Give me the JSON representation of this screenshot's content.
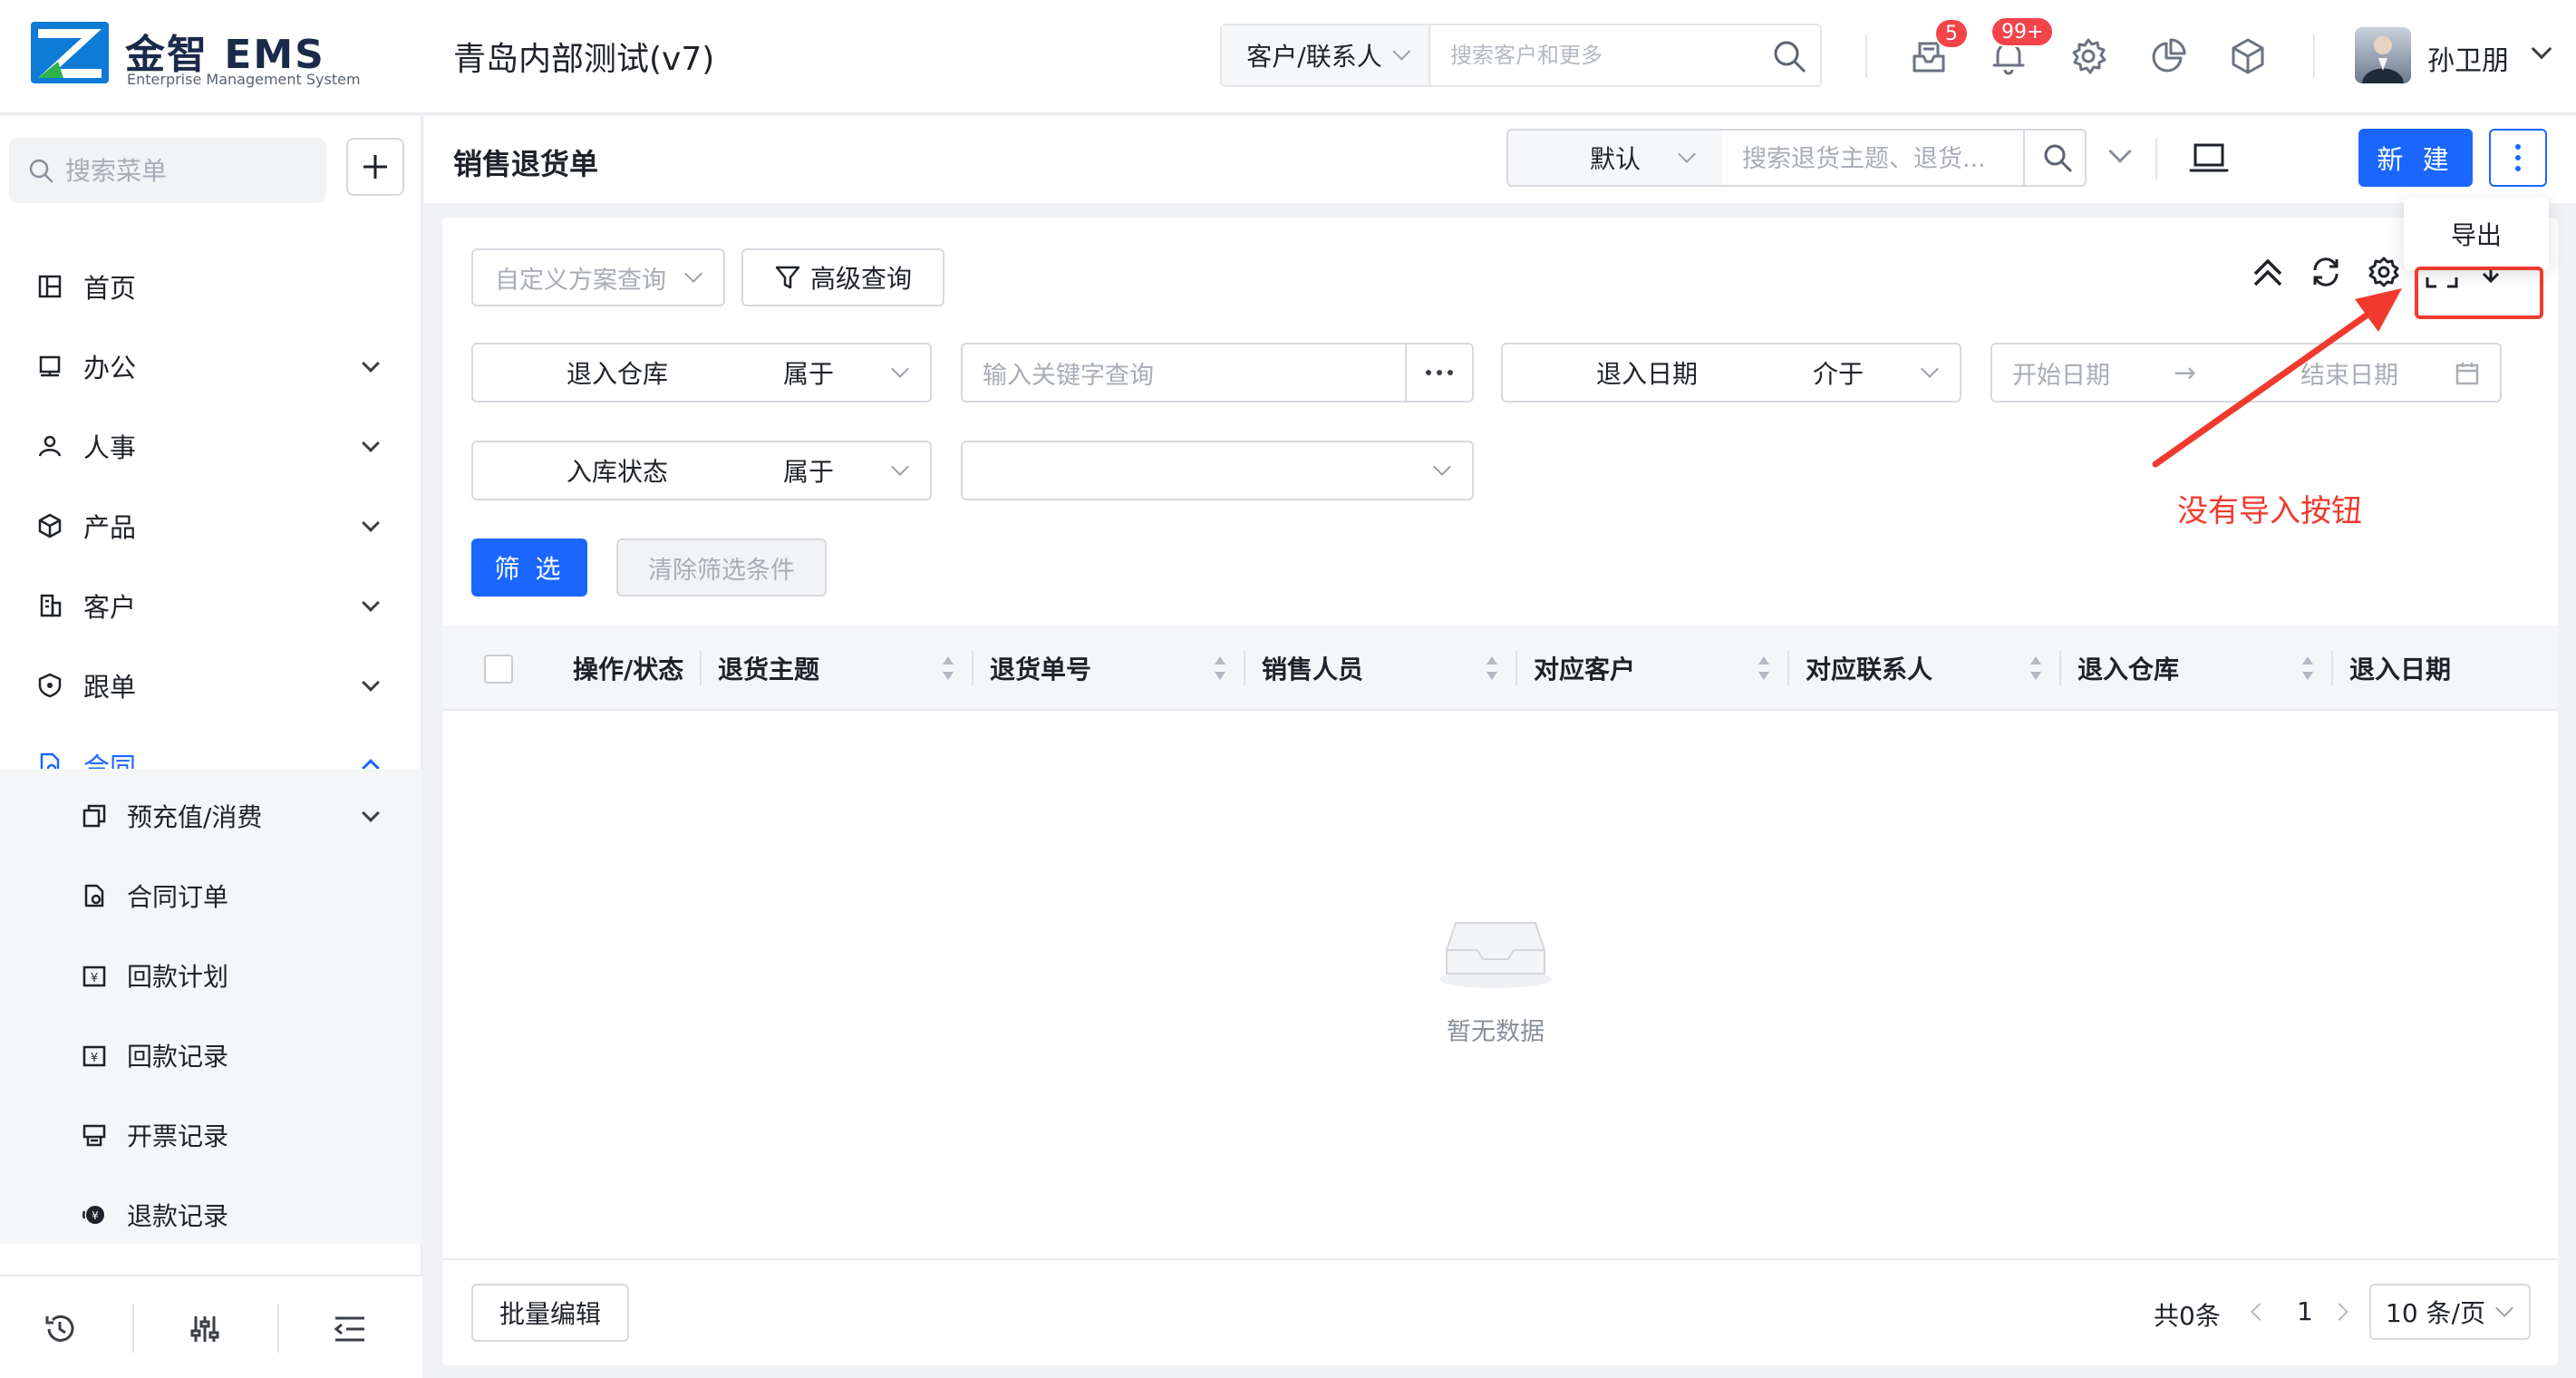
{
  "header": {
    "logo_main": "金智 EMS",
    "logo_sub": "Enterprise Management System",
    "company": "青岛内部测试(v7)",
    "search_type": "客户/联系人",
    "search_placeholder": "搜索客户和更多",
    "msg_badge": "5",
    "notice_badge": "99+",
    "user_name": "孙卫朋"
  },
  "sidebar": {
    "search_placeholder": "搜索菜单",
    "items": [
      {
        "label": "首页",
        "icon": "dashboard-icon"
      },
      {
        "label": "办公",
        "icon": "office-icon"
      },
      {
        "label": "人事",
        "icon": "personnel-icon"
      },
      {
        "label": "产品",
        "icon": "product-icon"
      },
      {
        "label": "客户",
        "icon": "customer-icon"
      },
      {
        "label": "跟单",
        "icon": "followup-icon"
      },
      {
        "label": "合同",
        "icon": "contract-icon"
      }
    ],
    "subitems": [
      {
        "label": "预充值/消费",
        "icon": "prepaid-icon"
      },
      {
        "label": "合同订单",
        "icon": "contract-order-icon"
      },
      {
        "label": "回款计划",
        "icon": "payment-plan-icon"
      },
      {
        "label": "回款记录",
        "icon": "payment-record-icon"
      },
      {
        "label": "开票记录",
        "icon": "invoice-icon"
      },
      {
        "label": "退款记录",
        "icon": "refund-icon"
      }
    ]
  },
  "page": {
    "title": "销售退货单",
    "view": "默认",
    "search_placeholder": "搜索退货主题、退货...",
    "new_label": "新 建",
    "menu_export": "导出"
  },
  "filters": {
    "plan_placeholder": "自定义方案查询",
    "advanced_label": "高级查询",
    "warehouse_label": "退入仓库",
    "warehouse_op": "属于",
    "keyword_placeholder": "输入关键字查询",
    "date_label": "退入日期",
    "date_op": "介于",
    "date_start": "开始日期",
    "date_arrow": "→",
    "date_end": "结束日期",
    "status_label": "入库状态",
    "status_op": "属于",
    "filter_btn": "筛 选",
    "clear_btn": "清除筛选条件"
  },
  "table": {
    "columns": [
      "操作/状态",
      "退货主题",
      "退货单号",
      "销售人员",
      "对应客户",
      "对应联系人",
      "退入仓库",
      "退入日期"
    ],
    "empty_text": "暂无数据"
  },
  "footer": {
    "batch_edit": "批量编辑",
    "total": "共0条",
    "page": "1",
    "page_size": "10 条/页"
  },
  "annotation": {
    "text": "没有导入按钮",
    "color": "#f03a2e"
  },
  "colors": {
    "primary": "#1a66ff",
    "badge": "#f5434b"
  }
}
